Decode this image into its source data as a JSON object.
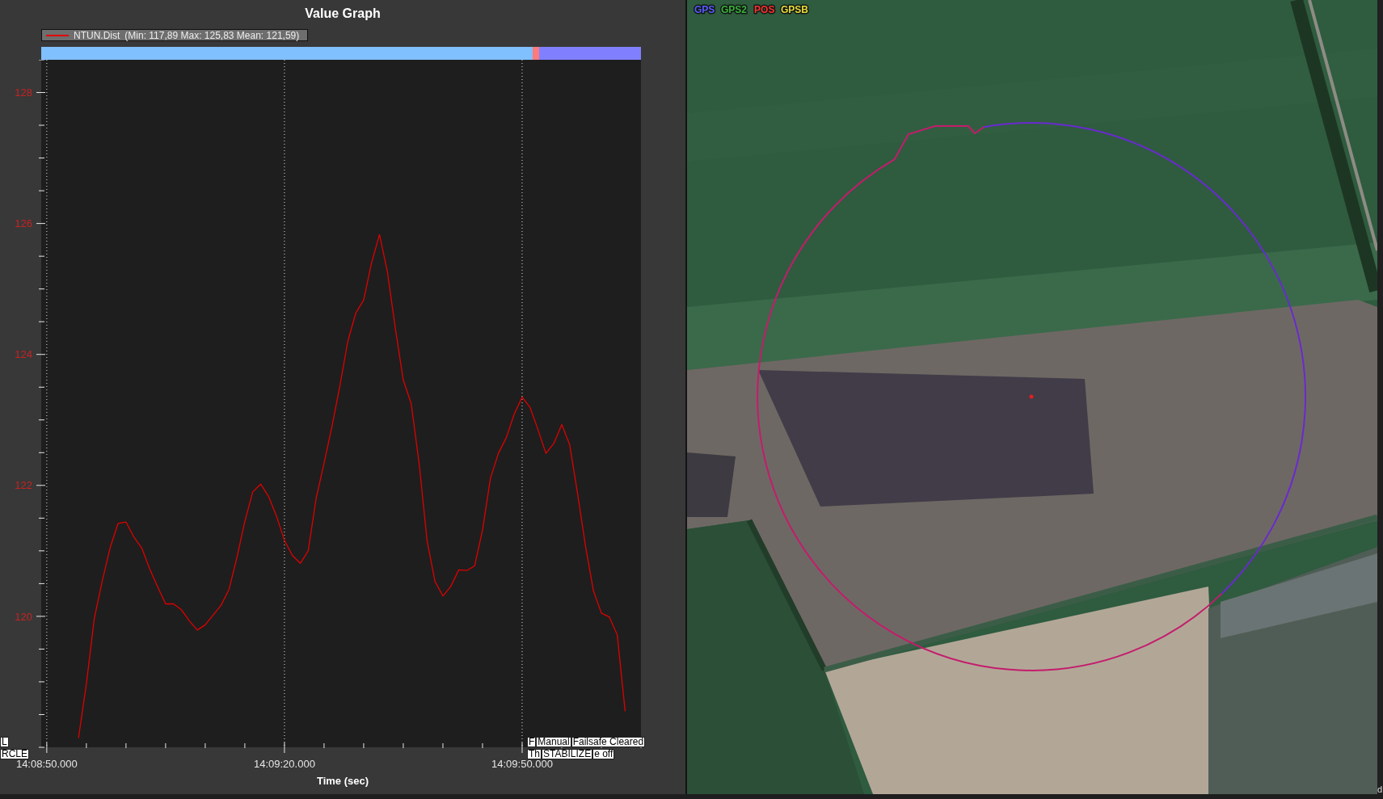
{
  "graph": {
    "chart_data": {
      "type": "line",
      "title": "Value Graph",
      "xlabel": "Time (sec)",
      "grid": true,
      "categories": [
        "14:08:50.000",
        null,
        null,
        null,
        null,
        null,
        null,
        null,
        null,
        null,
        null,
        null,
        null,
        null,
        null,
        null,
        null,
        null,
        null,
        null,
        null,
        null,
        null,
        null,
        null,
        null,
        null,
        null,
        null,
        null,
        "14:09:20.000",
        null,
        null,
        null,
        null,
        null,
        null,
        null,
        null,
        null,
        null,
        null,
        null,
        null,
        null,
        null,
        null,
        null,
        null,
        null,
        null,
        null,
        null,
        null,
        null,
        null,
        null,
        null,
        null,
        null,
        "14:09:50.000",
        null,
        null,
        null,
        null,
        null,
        null,
        null,
        null,
        null,
        null,
        null,
        null,
        null,
        null,
        null
      ],
      "series": [
        {
          "name": "NTUN.Dist",
          "color": "#e00000",
          "values": [
            null,
            null,
            null,
            null,
            118.14,
            118.97,
            119.97,
            120.54,
            121.05,
            121.42,
            121.44,
            121.21,
            121.04,
            120.72,
            120.45,
            120.19,
            120.19,
            120.1,
            119.93,
            119.79,
            119.87,
            120.02,
            120.17,
            120.41,
            120.9,
            121.45,
            121.9,
            122.02,
            121.83,
            121.53,
            121.16,
            120.93,
            120.81,
            121.0,
            121.8,
            122.34,
            122.9,
            123.52,
            124.2,
            124.63,
            124.83,
            125.4,
            125.83,
            125.26,
            124.4,
            123.61,
            123.25,
            122.34,
            121.15,
            120.53,
            120.31,
            120.46,
            120.71,
            120.7,
            120.77,
            121.32,
            122.11,
            122.49,
            122.73,
            123.09,
            123.35,
            123.19,
            122.85,
            122.49,
            122.64,
            122.93,
            122.62,
            121.87,
            121.07,
            120.39,
            120.05,
            119.99,
            119.72,
            118.55,
            null,
            null
          ]
        }
      ],
      "ylim": [
        118,
        128.5
      ],
      "yticks": [
        120,
        122,
        124,
        126,
        128
      ]
    },
    "legend_stats": "(Min: 117,89 Max: 125,83 Mean: 121,59)",
    "mode_bar": [
      {
        "color": "#80c0ff",
        "level": 0.819
      },
      {
        "color": "#ff7a7a",
        "level": 0.011
      },
      {
        "color": "#8080ff",
        "level": 0.17
      }
    ],
    "event_labels": [
      {
        "rows": [
          [
            "L"
          ],
          [
            "RCLE"
          ]
        ]
      },
      {
        "rows": [
          [
            "F",
            "Manual",
            "Failsafe Cleared"
          ],
          [
            "Th",
            "STABILIZE",
            "e off"
          ]
        ]
      }
    ]
  },
  "map": {
    "legend": [
      {
        "label": "GPS",
        "color": "#5a5aff"
      },
      {
        "label": "GPS2",
        "color": "#3cae3c"
      },
      {
        "label": "POS",
        "color": "#ff3030"
      },
      {
        "label": "GPSB",
        "color": "#e8d838"
      }
    ],
    "side_text": "d"
  }
}
